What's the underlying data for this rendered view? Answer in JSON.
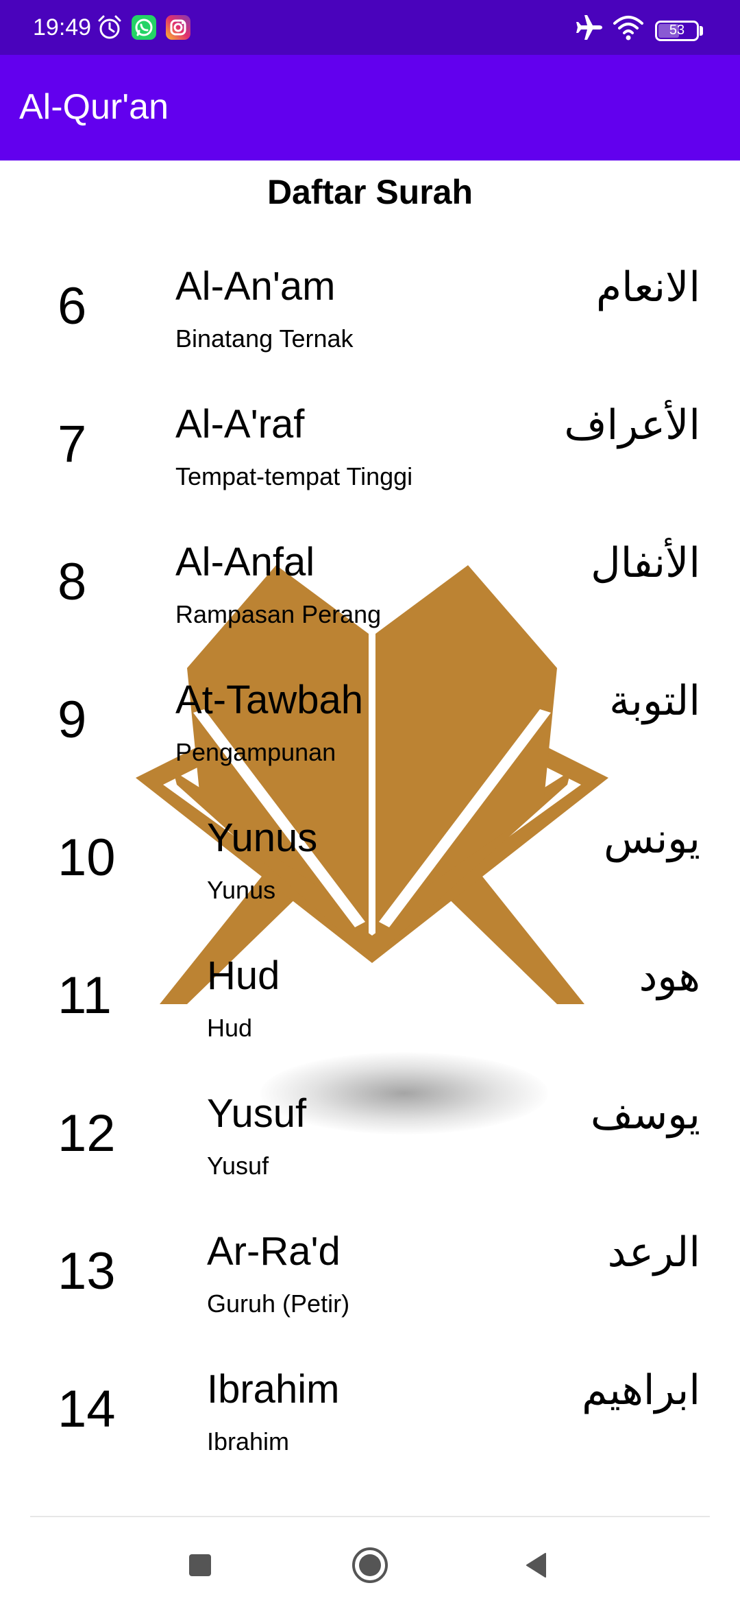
{
  "status_bar": {
    "time": "19:49",
    "battery": "53",
    "icons": [
      "alarm-icon",
      "whatsapp-icon",
      "instagram-icon",
      "airplane-icon",
      "wifi-icon",
      "battery-icon"
    ],
    "background": "#4A03BC"
  },
  "app_bar": {
    "title": "Al-Qur'an",
    "background": "#6200EE"
  },
  "list": {
    "heading": "Daftar Surah",
    "items": [
      {
        "number": "6",
        "name": "Al-An'am",
        "meaning": "Binatang Ternak",
        "arabic": "الانعام"
      },
      {
        "number": "7",
        "name": "Al-A'raf",
        "meaning": "Tempat-tempat Tinggi",
        "arabic": "الأعراف"
      },
      {
        "number": "8",
        "name": "Al-Anfal",
        "meaning": "Rampasan Perang",
        "arabic": "الأنفال"
      },
      {
        "number": "9",
        "name": "At-Tawbah",
        "meaning": "Pengampunan",
        "arabic": "التوبة"
      },
      {
        "number": "10",
        "name": "Yunus",
        "meaning": "Yunus",
        "arabic": "يونس"
      },
      {
        "number": "11",
        "name": "Hud",
        "meaning": "Hud",
        "arabic": "هود"
      },
      {
        "number": "12",
        "name": "Yusuf",
        "meaning": "Yusuf",
        "arabic": "يوسف"
      },
      {
        "number": "13",
        "name": "Ar-Ra'd",
        "meaning": "Guruh (Petir)",
        "arabic": "الرعد"
      },
      {
        "number": "14",
        "name": "Ibrahim",
        "meaning": "Ibrahim",
        "arabic": "ابراهيم"
      }
    ]
  },
  "background_image": {
    "icon": "quran-book-icon",
    "color": "#BC8333"
  },
  "nav_bar": {
    "icons": [
      "recent-apps-icon",
      "home-icon",
      "back-icon"
    ]
  }
}
